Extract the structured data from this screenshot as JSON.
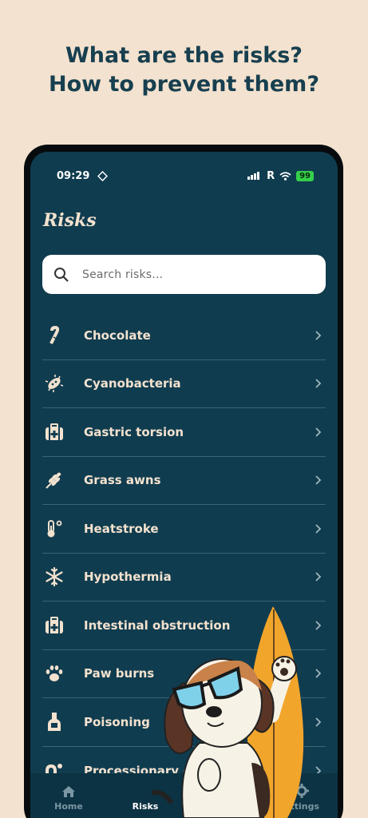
{
  "headline": {
    "line1": "What are the risks?",
    "line2": "How to prevent them?"
  },
  "status_bar": {
    "time": "09:29",
    "signal": "R",
    "battery": "99"
  },
  "page_title": "Risks",
  "search": {
    "placeholder": "Search risks..."
  },
  "risks": [
    {
      "label": "Chocolate",
      "icon": "candy-cane-icon"
    },
    {
      "label": "Cyanobacteria",
      "icon": "bacteria-icon"
    },
    {
      "label": "Gastric torsion",
      "icon": "medical-kit-icon"
    },
    {
      "label": "Grass awns",
      "icon": "grass-awn-icon"
    },
    {
      "label": "Heatstroke",
      "icon": "thermometer-icon"
    },
    {
      "label": "Hypothermia",
      "icon": "snowflake-icon"
    },
    {
      "label": "Intestinal obstruction",
      "icon": "medical-kit-icon"
    },
    {
      "label": "Paw burns",
      "icon": "paw-icon"
    },
    {
      "label": "Poisoning",
      "icon": "poison-bottle-icon"
    },
    {
      "label": "Processionary c",
      "icon": "caterpillar-icon"
    }
  ],
  "tabs": [
    {
      "label": "Home",
      "icon": "home-icon",
      "active": false
    },
    {
      "label": "Risks",
      "icon": "risks-icon",
      "active": true
    },
    {
      "label": "ettings",
      "icon": "gear-icon",
      "active": false
    }
  ],
  "colors": {
    "background": "#f3e2cf",
    "screen": "#103c4f",
    "text_light": "#f3e2cf",
    "headline": "#173f4f"
  }
}
